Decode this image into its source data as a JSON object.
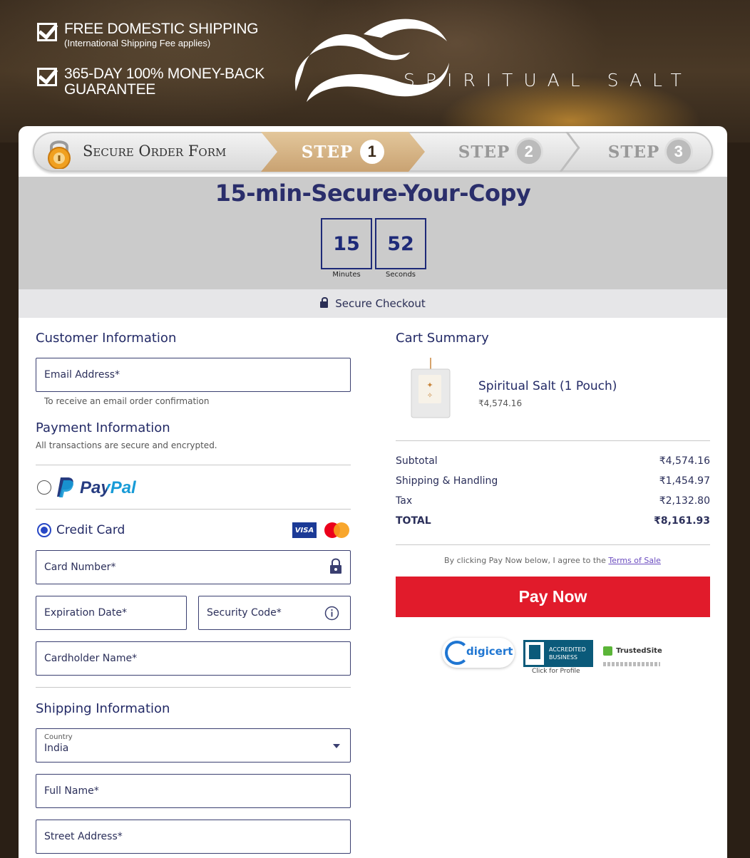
{
  "header": {
    "promo1_title": "FREE DOMESTIC SHIPPING",
    "promo1_sub": "(International Shipping Fee applies)",
    "promo2_title_line1": "365-DAY 100% MONEY-BACK",
    "promo2_title_line2": "GUARANTEE",
    "brand": "SPIRITUAL SALT"
  },
  "steps": {
    "secure_label": "Secure Order Form",
    "step_word": "STEP",
    "step1": "1",
    "step2": "2",
    "step3": "3"
  },
  "timer": {
    "title": "15-min-Secure-Your-Copy",
    "minutes": "15",
    "seconds": "52",
    "minutes_label": "Minutes",
    "seconds_label": "Seconds"
  },
  "secure_checkout": "Secure Checkout",
  "customer": {
    "title": "Customer Information",
    "email_placeholder": "Email Address*",
    "email_hint": "To receive an email order confirmation"
  },
  "payment": {
    "title": "Payment Information",
    "subtitle": "All transactions are secure and encrypted.",
    "paypal_label": "PayPal",
    "credit_card_label": "Credit Card",
    "visa_label": "VISA",
    "card_number": "Card Number*",
    "expiration": "Expiration Date*",
    "security_code": "Security Code*",
    "cardholder": "Cardholder Name*"
  },
  "shipping": {
    "title": "Shipping Information",
    "country_label": "Country",
    "country_value": "India",
    "full_name": "Full Name*",
    "street": "Street Address*"
  },
  "cart": {
    "title": "Cart Summary",
    "product_name": "Spiritual Salt (1 Pouch)",
    "product_price": "₹4,574.16",
    "rows": [
      {
        "label": "Subtotal",
        "value": "₹4,574.16"
      },
      {
        "label": "Shipping & Handling",
        "value": "₹1,454.97"
      },
      {
        "label": "Tax",
        "value": "₹2,132.80"
      },
      {
        "label": "TOTAL",
        "value": "₹8,161.93"
      }
    ],
    "terms_text": "By clicking Pay Now below, I agree to the ",
    "terms_link": "Terms of Sale",
    "pay_button": "Pay Now"
  },
  "trust": {
    "digicert": "digicert",
    "bbb_line1": "ACCREDITED",
    "bbb_line2": "BUSINESS",
    "bbb_caption": "Click for Profile",
    "trusted": "TrustedSite"
  },
  "colors": {
    "accent": "#232a66",
    "pay": "#e11b2b",
    "radio": "#2747c5"
  }
}
